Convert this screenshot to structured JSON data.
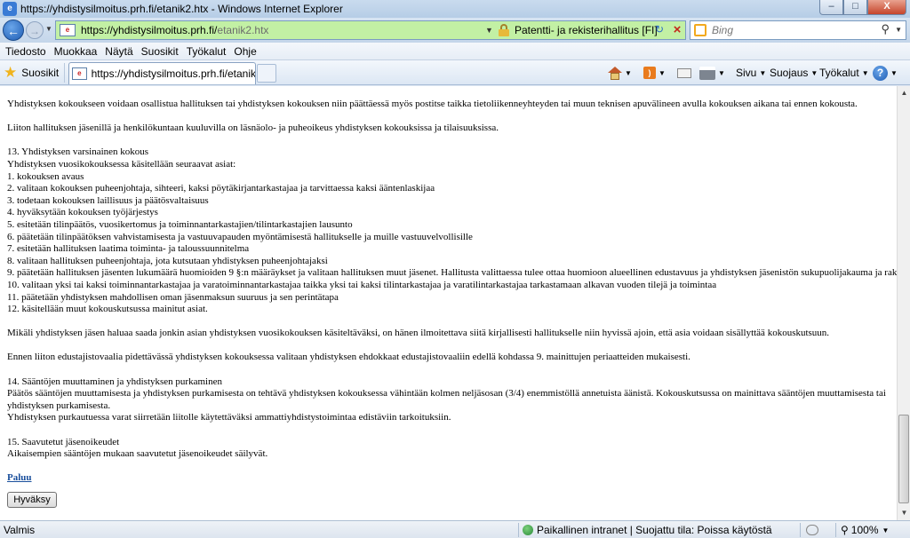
{
  "window": {
    "title": "https://yhdistysilmoitus.prh.fi/etanik2.htx - Windows Internet Explorer",
    "minimize": "–",
    "maximize": "□",
    "close": "X"
  },
  "address": {
    "url_host": "https://yhdistysilmoitus.prh.fi/",
    "url_path": "etanik2.htx",
    "cert_label": "Patentti- ja rekisterihallitus [FI]",
    "search_placeholder": "Bing"
  },
  "menu": [
    "Tiedosto",
    "Muokkaa",
    "Näytä",
    "Suosikit",
    "Työkalut",
    "Ohje"
  ],
  "favbar": {
    "favorites_label": "Suosikit",
    "tab_label": "https://yhdistysilmoitus.prh.fi/etanik2...",
    "page_menu": "Sivu",
    "safety_menu": "Suojaus",
    "tools_menu": "Työkalut",
    "help": "?"
  },
  "content": {
    "paragraphs": [
      [
        "Yhdistyksen kokoukseen voidaan osallistua hallituksen tai yhdistyksen kokouksen niin päättäessä myös postitse taikka tietoliikenneyhteyden tai muun teknisen apuvälineen avulla kokouksen aikana tai ennen kokousta."
      ],
      [
        "Liiton hallituksen jäsenillä ja henkilökuntaan kuuluvilla on läsnäolo- ja puheoikeus yhdistyksen kokouksissa ja tilaisuuksissa."
      ],
      [
        "13. Yhdistyksen varsinainen kokous",
        "Yhdistyksen vuosikokouksessa käsitellään seuraavat asiat:",
        "1. kokouksen avaus",
        "2. valitaan kokouksen puheenjohtaja, sihteeri, kaksi pöytäkirjantarkastajaa ja tarvittaessa kaksi ääntenlaskijaa",
        "3. todetaan kokouksen laillisuus ja päätösvaltaisuus",
        "4. hyväksytään kokouksen työjärjestys",
        "5. esitetään tilinpäätös, vuosikertomus ja toiminnantarkastajien/tilintarkastajien lausunto",
        "6. päätetään tilinpäätöksen vahvistamisesta ja vastuuvapauden myöntämisestä hallitukselle ja muille vastuuvelvollisille",
        "7. esitetään hallituksen laatima toiminta- ja taloussuunnitelma",
        "8. valitaan hallituksen puheenjohtaja, jota kutsutaan yhdistyksen puheenjohtajaksi",
        "9. päätetään hallituksen jäsenten lukumäärä huomioiden 9 §:n määräykset ja valitaan hallituksen muut jäsenet. Hallitusta valittaessa tulee ottaa huomioon alueellinen edustavuus ja yhdistyksen jäsenistön sukupuolijakauma ja rakenne",
        "10. valitaan yksi tai kaksi toiminnantarkastajaa ja varatoiminnantarkastajaa taikka yksi tai kaksi tilintarkastajaa ja varatilintarkastajaa tarkastamaan alkavan vuoden tilejä ja toimintaa",
        "11. päätetään yhdistyksen mahdollisen oman jäsenmaksun suuruus ja sen perintätapa",
        "12. käsitellään muut kokouskutsussa mainitut asiat."
      ],
      [
        "Mikäli yhdistyksen jäsen haluaa saada jonkin asian yhdistyksen vuosikokouksen käsiteltäväksi, on hänen ilmoitettava siitä kirjallisesti hallitukselle niin hyvissä ajoin, että asia voidaan sisällyttää kokouskutsuun."
      ],
      [
        "Ennen liiton edustajistovaalia pidettävässä yhdistyksen kokouksessa valitaan yhdistyksen ehdokkaat edustajistovaaliin edellä kohdassa 9. mainittujen periaatteiden mukaisesti."
      ],
      [
        "14. Sääntöjen muuttaminen ja yhdistyksen purkaminen",
        "Päätös sääntöjen muuttamisesta ja yhdistyksen purkamisesta on tehtävä yhdistyksen kokouksessa vähintään kolmen neljäsosan (3/4) enemmistöllä annetuista äänistä. Kokouskutsussa on mainittava sääntöjen muuttamisesta tai",
        "yhdistyksen purkamisesta.",
        "Yhdistyksen purkautuessa varat siirretään liitolle käytettäväksi ammattiyhdistystoimintaa edistäviin tarkoituksiin."
      ],
      [
        "15. Saavutetut jäsenoikeudet",
        "Aikaisempien sääntöjen mukaan saavutetut jäsenoikeudet säilyvät."
      ]
    ],
    "back_link": "Paluu",
    "accept_button": "Hyväksy"
  },
  "status": {
    "text": "Valmis",
    "zone": "Paikallinen intranet | Suojattu tila: Poissa käytöstä",
    "zoom": "100%"
  }
}
